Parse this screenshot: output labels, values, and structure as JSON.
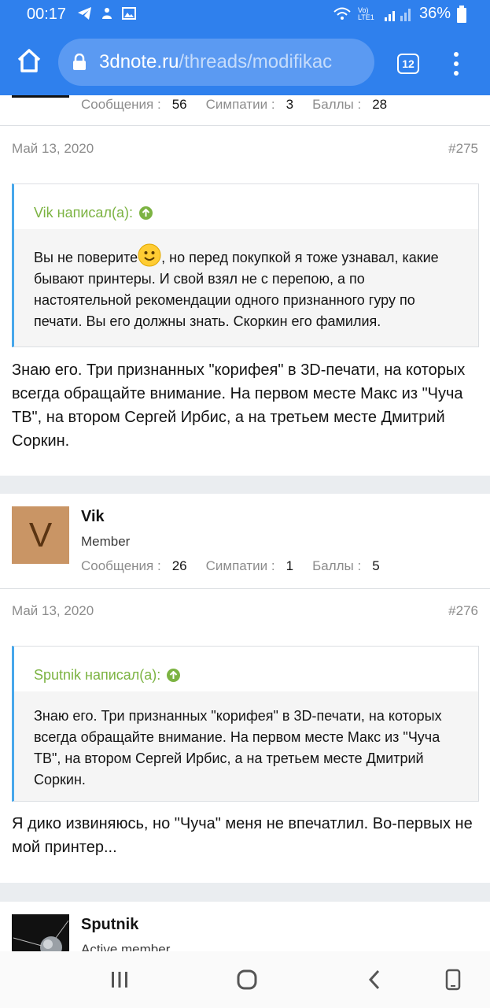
{
  "status_bar": {
    "time": "00:17",
    "battery": "36%",
    "network": "Vo) LTE1",
    "icons": [
      "telegram-icon",
      "notification-icon",
      "image-icon",
      "wifi-icon",
      "signal-icon",
      "battery-icon"
    ]
  },
  "browser": {
    "url_host": "3dnote.ru",
    "url_path": "/threads/modifikac",
    "tab_count": "12"
  },
  "posts": [
    {
      "author_stats": {
        "messages_label": "Сообщения :",
        "messages": "56",
        "likes_label": "Симпатии :",
        "likes": "3",
        "points_label": "Баллы :",
        "points": "28"
      },
      "date": "Май 13, 2020",
      "number": "#275",
      "quote": {
        "author": "Vik написал(а):",
        "text_before": "Вы не поверите",
        "text_after": ", но перед покупкой я тоже узнавал, какие бывают принтеры. И свой взял не с перепою, а по настоятельной рекомендации одного признанного гуру по печати. Вы его должны знать. Скоркин его фамилия."
      },
      "text": "Знаю его. Три признанных \"корифея\" в 3D-печати, на которых всегда обращайте внимание. На первом месте Макс из \"Чуча ТВ\", на втором Сергей Ирбис, а на третьем месте Дмитрий Соркин."
    },
    {
      "author": {
        "name": "Vik",
        "role": "Member",
        "avatar_letter": "V"
      },
      "author_stats": {
        "messages_label": "Сообщения :",
        "messages": "26",
        "likes_label": "Симпатии :",
        "likes": "1",
        "points_label": "Баллы :",
        "points": "5"
      },
      "date": "Май 13, 2020",
      "number": "#276",
      "quote": {
        "author": "Sputnik написал(а):",
        "text": "Знаю его. Три признанных \"корифея\" в 3D-печати, на которых всегда обращайте внимание. На первом месте Макс из \"Чуча ТВ\", на втором Сергей Ирбис, а на третьем месте Дмитрий Соркин."
      },
      "text": "Я дико извиняюсь, но \"Чуча\" меня не впечатлил. Во-первых не мой принтер..."
    },
    {
      "author": {
        "name": "Sputnik",
        "role": "Active member"
      }
    }
  ],
  "colors": {
    "accent": "#2f80ed",
    "quote_author": "#7cb342",
    "quote_border": "#47a7eb",
    "avatar_v": "#c99565"
  }
}
